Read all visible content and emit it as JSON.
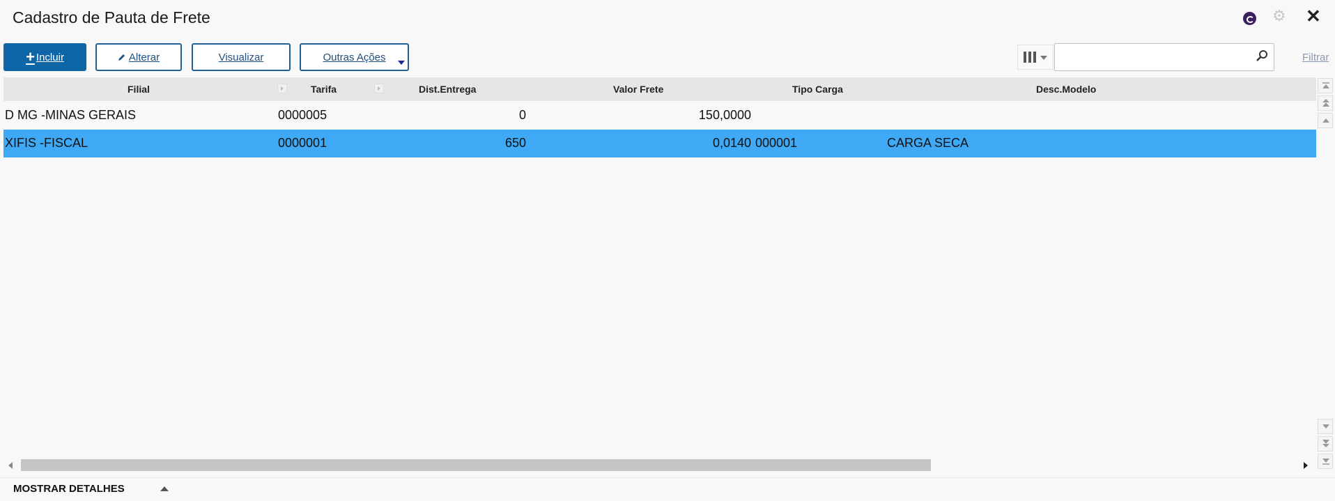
{
  "window": {
    "title": "Cadastro de Pauta de Frete",
    "app_icon": "totvs-logo-icon",
    "settings_icon": "gear-icon",
    "close_icon": "close-icon"
  },
  "toolbar": {
    "include_label": "Incluir",
    "alter_label": "Alterar",
    "view_label": "Visualizar",
    "other_actions_label": "Outras Ações",
    "filter_label": "Filtrar",
    "search_value": "",
    "search_placeholder": ""
  },
  "colors": {
    "primary": "#0f66a7",
    "selected_row": "#3fa9f5",
    "header_bg": "#e6e6e6"
  },
  "grid": {
    "columns": [
      "Filial",
      "Tarifa",
      "Dist.Entrega",
      "Valor Frete",
      "Tipo Carga",
      "Desc.Modelo"
    ],
    "rows": [
      {
        "filial": "D MG -MINAS GERAIS",
        "tarifa": "0000005",
        "dist_entrega": "0",
        "valor_frete": "150,0000",
        "tipo_carga": "",
        "desc_modelo": "",
        "selected": false
      },
      {
        "filial": "XIFIS -FISCAL",
        "tarifa": "0000001",
        "dist_entrega": "650",
        "valor_frete": "0,0140",
        "tipo_carga": "000001",
        "desc_modelo": "CARGA SECA",
        "selected": true
      }
    ]
  },
  "footer": {
    "details_label": "MOSTRAR DETALHES"
  }
}
